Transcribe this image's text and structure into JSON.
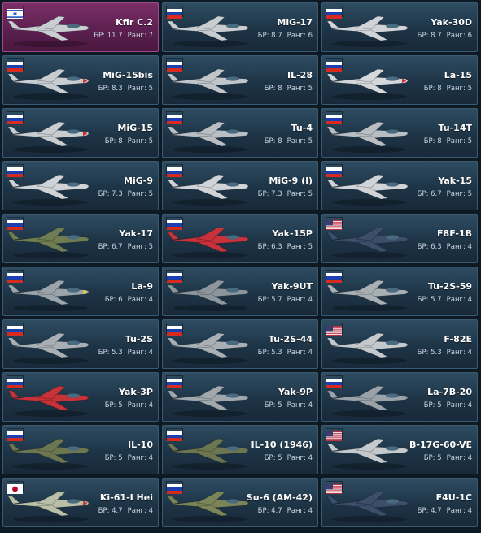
{
  "colors": {
    "card_bg": "#1d3446",
    "selected_bg": "#6b2758",
    "text_white": "#ffffff",
    "text_stats": "#c9d6df"
  },
  "labels": {
    "br_prefix": "БР:",
    "rank_prefix": "Ранг:"
  },
  "vehicles": [
    {
      "name": "Kfir C.2",
      "br": "11.7",
      "rank": "7",
      "nation": "israel",
      "plane_color": "#c9ced2",
      "accent": "#c9ced2",
      "selected": true
    },
    {
      "name": "MiG-17",
      "br": "8.7",
      "rank": "6",
      "nation": "ussr",
      "plane_color": "#c8cdd1",
      "accent": "#c8cdd1",
      "selected": false
    },
    {
      "name": "Yak-30D",
      "br": "8.7",
      "rank": "6",
      "nation": "ussr",
      "plane_color": "#d0d4d8",
      "accent": "#d0d4d8",
      "selected": false
    },
    {
      "name": "MiG-15bis",
      "br": "8.3",
      "rank": "5",
      "nation": "ussr",
      "plane_color": "#c8cdd1",
      "accent": "#d03030",
      "selected": false
    },
    {
      "name": "IL-28",
      "br": "8",
      "rank": "5",
      "nation": "ussr",
      "plane_color": "#bfc5c9",
      "accent": "#bfc5c9",
      "selected": false
    },
    {
      "name": "La-15",
      "br": "8",
      "rank": "5",
      "nation": "ussr",
      "plane_color": "#d4d8db",
      "accent": "#d03030",
      "selected": false
    },
    {
      "name": "MiG-15",
      "br": "8",
      "rank": "5",
      "nation": "ussr",
      "plane_color": "#c8cdd1",
      "accent": "#d03030",
      "selected": false
    },
    {
      "name": "Tu-4",
      "br": "8",
      "rank": "5",
      "nation": "ussr",
      "plane_color": "#b8bec3",
      "accent": "#b8bec3",
      "selected": false
    },
    {
      "name": "Tu-14T",
      "br": "8",
      "rank": "5",
      "nation": "ussr",
      "plane_color": "#b8bec3",
      "accent": "#b8bec3",
      "selected": false
    },
    {
      "name": "MiG-9",
      "br": "7.3",
      "rank": "5",
      "nation": "ussr",
      "plane_color": "#d0d4d8",
      "accent": "#d0d4d8",
      "selected": false
    },
    {
      "name": "MiG-9 (l)",
      "br": "7.3",
      "rank": "5",
      "nation": "ussr",
      "plane_color": "#d0d4d8",
      "accent": "#d0d4d8",
      "selected": false
    },
    {
      "name": "Yak-15",
      "br": "6.7",
      "rank": "5",
      "nation": "ussr",
      "plane_color": "#d0d4d8",
      "accent": "#d0d4d8",
      "selected": false
    },
    {
      "name": "Yak-17",
      "br": "6.7",
      "rank": "5",
      "nation": "ussr",
      "plane_color": "#6f7d52",
      "accent": "#6f7d52",
      "selected": false
    },
    {
      "name": "Yak-15P",
      "br": "6.3",
      "rank": "5",
      "nation": "ussr",
      "plane_color": "#c8323a",
      "accent": "#c8323a",
      "selected": false
    },
    {
      "name": "F8F-1B",
      "br": "6.3",
      "rank": "4",
      "nation": "usa",
      "plane_color": "#3c4e6a",
      "accent": "#3c4e6a",
      "selected": false
    },
    {
      "name": "La-9",
      "br": "6",
      "rank": "4",
      "nation": "ussr",
      "plane_color": "#9aa4aa",
      "accent": "#e0d040",
      "selected": false
    },
    {
      "name": "Yak-9UT",
      "br": "5.7",
      "rank": "4",
      "nation": "ussr",
      "plane_color": "#8c969c",
      "accent": "#8c969c",
      "selected": false
    },
    {
      "name": "Tu-2S-59",
      "br": "5.7",
      "rank": "4",
      "nation": "ussr",
      "plane_color": "#a8b0b5",
      "accent": "#a8b0b5",
      "selected": false
    },
    {
      "name": "Tu-2S",
      "br": "5.3",
      "rank": "4",
      "nation": "ussr",
      "plane_color": "#a8b0b5",
      "accent": "#a8b0b5",
      "selected": false
    },
    {
      "name": "Tu-2S-44",
      "br": "5.3",
      "rank": "4",
      "nation": "ussr",
      "plane_color": "#a8b0b5",
      "accent": "#a8b0b5",
      "selected": false
    },
    {
      "name": "F-82E",
      "br": "5.3",
      "rank": "4",
      "nation": "usa",
      "plane_color": "#c4c9cd",
      "accent": "#c4c9cd",
      "selected": false
    },
    {
      "name": "Yak-3P",
      "br": "5",
      "rank": "4",
      "nation": "ussr",
      "plane_color": "#c63238",
      "accent": "#c63238",
      "selected": false
    },
    {
      "name": "Yak-9P",
      "br": "5",
      "rank": "4",
      "nation": "ussr",
      "plane_color": "#a0a8ad",
      "accent": "#a0a8ad",
      "selected": false
    },
    {
      "name": "La-7B-20",
      "br": "5",
      "rank": "4",
      "nation": "ussr",
      "plane_color": "#9aa3a9",
      "accent": "#9aa3a9",
      "selected": false
    },
    {
      "name": "IL-10",
      "br": "5",
      "rank": "4",
      "nation": "ussr",
      "plane_color": "#6c7650",
      "accent": "#6c7650",
      "selected": false
    },
    {
      "name": "IL-10 (1946)",
      "br": "5",
      "rank": "4",
      "nation": "ussr",
      "plane_color": "#6c7650",
      "accent": "#6c7650",
      "selected": false
    },
    {
      "name": "B-17G-60-VE",
      "br": "5",
      "rank": "4",
      "nation": "usa",
      "plane_color": "#c4c9cd",
      "accent": "#c4c9cd",
      "selected": false
    },
    {
      "name": "Ki-61-I Hei",
      "br": "4.7",
      "rank": "4",
      "nation": "japan",
      "plane_color": "#b8bfa6",
      "accent": "#c83a3a",
      "selected": false
    },
    {
      "name": "Su-6 (AM-42)",
      "br": "4.7",
      "rank": "4",
      "nation": "ussr",
      "plane_color": "#7c8558",
      "accent": "#7c8558",
      "selected": false
    },
    {
      "name": "F4U-1C",
      "br": "4.7",
      "rank": "4",
      "nation": "usa",
      "plane_color": "#3c4e6a",
      "accent": "#3c4e6a",
      "selected": false
    }
  ]
}
